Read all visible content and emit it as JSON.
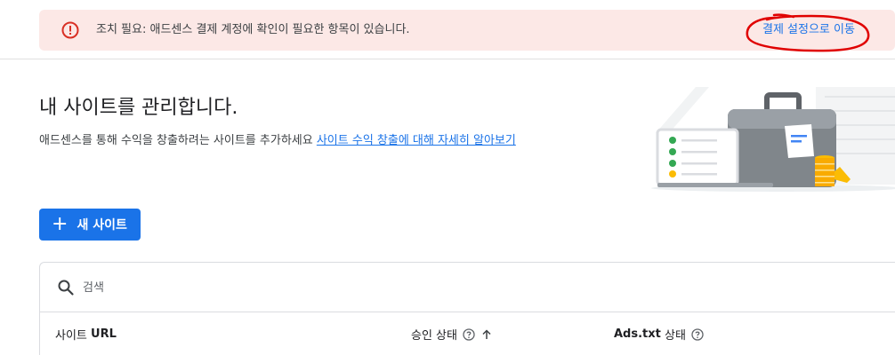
{
  "alert": {
    "message": "조치 필요: 애드센스 결제 계정에 확인이 필요한 항목이 있습니다.",
    "action_link": "결제 설정으로 이동",
    "colors": {
      "background": "#fce8e6",
      "icon": "#d93025",
      "link": "#1a73e8",
      "annotation": "#e00000"
    }
  },
  "page": {
    "title": "내 사이트를 관리합니다.",
    "description": "애드센스를 통해 수익을 창출하려는 사이트를 추가하세요",
    "learn_more_link": "사이트 수익 창출에 대해 자세히 알아보기"
  },
  "new_site_button": {
    "label": "새 사이트",
    "icon": "plus-icon",
    "color": "#1a73e8"
  },
  "table": {
    "search_placeholder": "검색",
    "columns": {
      "site_url": {
        "prefix": "사이트",
        "bold": "URL"
      },
      "approval_status": {
        "label": "승인 상태",
        "sort": "ascending"
      },
      "ads_txt_status": {
        "bold": "Ads.txt",
        "suffix": "상태"
      }
    }
  }
}
